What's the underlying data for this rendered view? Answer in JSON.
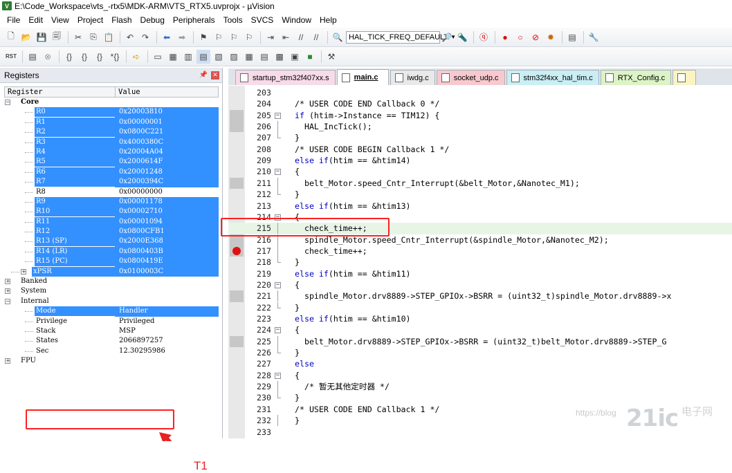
{
  "window": {
    "title": "E:\\Code_Workspace\\vts_-rtx5\\MDK-ARM\\VTS_RTX5.uvprojx - µVision"
  },
  "menu": [
    "File",
    "Edit",
    "View",
    "Project",
    "Flash",
    "Debug",
    "Peripherals",
    "Tools",
    "SVCS",
    "Window",
    "Help"
  ],
  "toolbar": {
    "target_combo": "HAL_TICK_FREQ_DEFAULT"
  },
  "registers_panel": {
    "title": "Registers",
    "columns": [
      "Register",
      "Value"
    ],
    "rows": [
      {
        "name": "Core",
        "value": "",
        "level": 0,
        "expander": "−",
        "bold": true,
        "sel": false
      },
      {
        "name": "R0",
        "value": "0x20003810",
        "level": 2,
        "sel": true
      },
      {
        "name": "R1",
        "value": "0x00000001",
        "level": 2,
        "sel": true
      },
      {
        "name": "R2",
        "value": "0x0800C221",
        "level": 2,
        "sel": true
      },
      {
        "name": "R3",
        "value": "0x4000380C",
        "level": 2,
        "sel": true
      },
      {
        "name": "R4",
        "value": "0x20004A04",
        "level": 2,
        "sel": true
      },
      {
        "name": "R5",
        "value": "0x2000614F",
        "level": 2,
        "sel": true
      },
      {
        "name": "R6",
        "value": "0x20001248",
        "level": 2,
        "sel": true
      },
      {
        "name": "R7",
        "value": "0x2000394C",
        "level": 2,
        "sel": true
      },
      {
        "name": "R8",
        "value": "0x00000000",
        "level": 2,
        "sel": false
      },
      {
        "name": "R9",
        "value": "0x00001178",
        "level": 2,
        "sel": true
      },
      {
        "name": "R10",
        "value": "0x00002710",
        "level": 2,
        "sel": true
      },
      {
        "name": "R11",
        "value": "0x00001094",
        "level": 2,
        "sel": true
      },
      {
        "name": "R12",
        "value": "0x0800CFB1",
        "level": 2,
        "sel": true
      },
      {
        "name": "R13 (SP)",
        "value": "0x2000E368",
        "level": 2,
        "sel": true
      },
      {
        "name": "R14 (LR)",
        "value": "0x0800403B",
        "level": 2,
        "sel": true
      },
      {
        "name": "R15 (PC)",
        "value": "0x0800419E",
        "level": 2,
        "sel": true
      },
      {
        "name": "xPSR",
        "value": "0x0100003C",
        "level": 1,
        "expander": "+",
        "sel": true
      },
      {
        "name": "Banked",
        "value": "",
        "level": 0,
        "expander": "+",
        "sel": false
      },
      {
        "name": "System",
        "value": "",
        "level": 0,
        "expander": "+",
        "sel": false
      },
      {
        "name": "Internal",
        "value": "",
        "level": 0,
        "expander": "−",
        "sel": false
      },
      {
        "name": "Mode",
        "value": "Handler",
        "level": 2,
        "sel": true
      },
      {
        "name": "Privilege",
        "value": "Privileged",
        "level": 2,
        "sel": false
      },
      {
        "name": "Stack",
        "value": "MSP",
        "level": 2,
        "sel": false
      },
      {
        "name": "States",
        "value": "2066897257",
        "level": 2,
        "sel": false
      },
      {
        "name": "Sec",
        "value": "12.30295986",
        "level": 2,
        "sel": false
      },
      {
        "name": "FPU",
        "value": "",
        "level": 0,
        "expander": "+",
        "sel": false
      }
    ],
    "annotation": "T1"
  },
  "editor": {
    "tabs": [
      {
        "label": "startup_stm32f407xx.s",
        "color": "#f7dbe9",
        "active": false
      },
      {
        "label": "main.c",
        "color": "#ffffff",
        "active": true
      },
      {
        "label": "iwdg.c",
        "color": "#e9e9e9",
        "active": false
      },
      {
        "label": "socket_udp.c",
        "color": "#f7c9cf",
        "active": false
      },
      {
        "label": "stm32f4xx_hal_tim.c",
        "color": "#c9eef3",
        "active": false
      },
      {
        "label": "RTX_Config.c",
        "color": "#dcf3c6",
        "active": false
      },
      {
        "label": "",
        "color": "#fbf3c1",
        "active": false
      }
    ],
    "lines": [
      {
        "n": "203",
        "code": "",
        "fold": ""
      },
      {
        "n": "204",
        "code": "/* USER CODE END Callback 0 */",
        "fold": "",
        "cls": "cmt"
      },
      {
        "n": "205",
        "code": "if (htim->Instance == TIM12) {",
        "fold": "box"
      },
      {
        "n": "206",
        "code": "  HAL_IncTick();",
        "fold": "line"
      },
      {
        "n": "207",
        "code": "}",
        "fold": "end"
      },
      {
        "n": "208",
        "code": "/* USER CODE BEGIN Callback 1 */",
        "fold": "",
        "cls": "cmt"
      },
      {
        "n": "209",
        "code": "else if(htim == &htim14)",
        "fold": ""
      },
      {
        "n": "210",
        "code": "{",
        "fold": "box"
      },
      {
        "n": "211",
        "code": "  belt_Motor.speed_Cntr_Interrupt(&belt_Motor,&Nanotec_M1);",
        "fold": "line"
      },
      {
        "n": "212",
        "code": "}",
        "fold": "end"
      },
      {
        "n": "213",
        "code": "else if(htim == &htim13)",
        "fold": ""
      },
      {
        "n": "214",
        "code": "{",
        "fold": "box"
      },
      {
        "n": "215",
        "code": "  check_time++;",
        "fold": "line",
        "current": true,
        "marker": "arrow"
      },
      {
        "n": "216",
        "code": "  spindle_Motor.speed_Cntr_Interrupt(&spindle_Motor,&Nanotec_M2);",
        "fold": "line"
      },
      {
        "n": "217",
        "code": "  check_time++;",
        "fold": "line",
        "marker": "breakpoint"
      },
      {
        "n": "218",
        "code": "}",
        "fold": "end"
      },
      {
        "n": "219",
        "code": "else if(htim == &htim11)",
        "fold": ""
      },
      {
        "n": "220",
        "code": "{",
        "fold": "box"
      },
      {
        "n": "221",
        "code": "  spindle_Motor.drv8889->STEP_GPIOx->BSRR = (uint32_t)spindle_Motor.drv8889->x",
        "fold": "line"
      },
      {
        "n": "222",
        "code": "}",
        "fold": "end"
      },
      {
        "n": "223",
        "code": "else if(htim == &htim10)",
        "fold": ""
      },
      {
        "n": "224",
        "code": "{",
        "fold": "box"
      },
      {
        "n": "225",
        "code": "  belt_Motor.drv8889->STEP_GPIOx->BSRR = (uint32_t)belt_Motor.drv8889->STEP_G",
        "fold": "line"
      },
      {
        "n": "226",
        "code": "}",
        "fold": "end"
      },
      {
        "n": "227",
        "code": "else",
        "fold": ""
      },
      {
        "n": "228",
        "code": "{",
        "fold": "box"
      },
      {
        "n": "229",
        "code": "  /* 暂无其他定时器 */",
        "fold": "line",
        "cls": "cmt"
      },
      {
        "n": "230",
        "code": "}",
        "fold": "end"
      },
      {
        "n": "231",
        "code": "/* USER CODE END Callback 1 */",
        "fold": "",
        "cls": "cmt"
      },
      {
        "n": "232",
        "code": "}",
        "fold": "end0"
      },
      {
        "n": "233",
        "code": "",
        "fold": ""
      }
    ]
  },
  "watermark": {
    "text": "https://blog",
    "logo": "21ic",
    "logo_sub": "电子网"
  },
  "colors": {
    "selection": "#3390ff",
    "annotation_red": "#ff2020",
    "comment": "#006400",
    "keyword": "#0000c8",
    "current_line": "#e8f5e6"
  }
}
